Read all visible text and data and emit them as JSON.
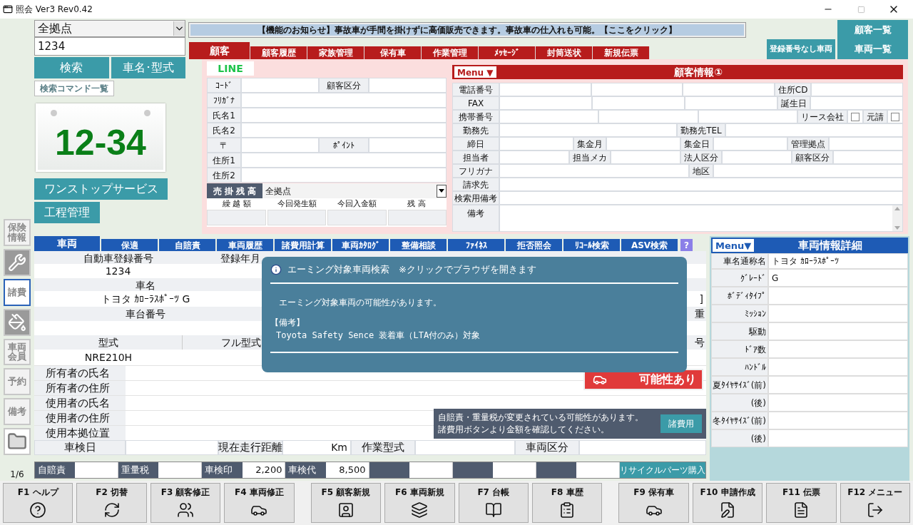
{
  "window": {
    "title": "照会 Ver3 Rev0.42"
  },
  "search": {
    "branch": "全拠点",
    "query": "1234",
    "buttons": [
      "検索",
      "車名･型式"
    ],
    "command_list": "検索コマンド一覧"
  },
  "plate": {
    "number": "12-34"
  },
  "side_buttons": [
    "ワンストップサービス",
    "工程管理"
  ],
  "notice": "【機能のお知らせ】事故車が手間を掛けずに高価販売できます。事故車の仕入れも可能。【ここをクリック】",
  "top_buttons": [
    "顧客一覧",
    "登録番号なし車両",
    "車両一覧"
  ],
  "customer_tabs": [
    {
      "label": "顧客",
      "selected": true
    },
    {
      "label": "顧客履歴",
      "selected": false
    },
    {
      "label": "家族管理",
      "selected": false
    },
    {
      "label": "保有車",
      "selected": false
    },
    {
      "label": "作業管理",
      "selected": false
    },
    {
      "label": "ﾒｯｾｰｼﾞ",
      "selected": false
    },
    {
      "label": "封筒送状",
      "selected": false
    },
    {
      "label": "新規伝票",
      "selected": false
    }
  ],
  "customer": {
    "line": "LINE",
    "rows": [
      [
        {
          "kind": "label",
          "text": "ｺｰﾄﾞ"
        },
        {
          "kind": "value"
        },
        {
          "kind": "label",
          "text": "顧客区分"
        },
        {
          "kind": "value"
        }
      ],
      [
        {
          "kind": "label",
          "text": "ﾌﾘｶﾞﾅ"
        },
        {
          "kind": "value"
        }
      ],
      [
        {
          "kind": "label",
          "text": "氏名1"
        },
        {
          "kind": "value"
        }
      ],
      [
        {
          "kind": "label",
          "text": "氏名2"
        },
        {
          "kind": "value"
        }
      ],
      [
        {
          "kind": "label",
          "text": "〒"
        },
        {
          "kind": "value"
        },
        {
          "kind": "label",
          "text": "ﾎﾟｲﾝﾄ"
        },
        {
          "kind": "value"
        }
      ],
      [
        {
          "kind": "label",
          "text": "住所1"
        },
        {
          "kind": "value"
        }
      ],
      [
        {
          "kind": "label",
          "text": "住所2"
        },
        {
          "kind": "value"
        }
      ]
    ],
    "balance": {
      "label": "売 掛 残 高",
      "branch": "全拠点",
      "columns": [
        "繰 越 額",
        "今回発生額",
        "今回入金額",
        "残 高"
      ]
    }
  },
  "customer_info": {
    "menu": "Menu ▼",
    "title": "顧客情報①",
    "rows": [
      [
        {
          "kind": "label",
          "text": "電話番号"
        },
        {
          "kind": "value"
        },
        {
          "kind": "value"
        },
        {
          "kind": "value"
        },
        {
          "kind": "label",
          "text": "住所CD"
        },
        {
          "kind": "value"
        }
      ],
      [
        {
          "kind": "label",
          "text": "FAX"
        },
        {
          "kind": "value"
        },
        {
          "kind": "value"
        },
        {
          "kind": "value"
        },
        {
          "kind": "label",
          "text": "誕生日"
        },
        {
          "kind": "value"
        }
      ],
      [
        {
          "kind": "label",
          "text": "携帯番号"
        },
        {
          "kind": "value"
        },
        {
          "kind": "value"
        },
        {
          "kind": "value"
        },
        {
          "kind": "label",
          "text": "リース会社"
        },
        {
          "kind": "checkbox",
          "checked": false
        },
        {
          "kind": "label",
          "text": "元請"
        },
        {
          "kind": "checkbox",
          "checked": false
        }
      ],
      [
        {
          "kind": "label",
          "text": "勤務先"
        },
        {
          "kind": "value"
        },
        {
          "kind": "label",
          "text": "勤務先TEL"
        },
        {
          "kind": "value"
        }
      ],
      [
        {
          "kind": "label",
          "text": "締日"
        },
        {
          "kind": "value"
        },
        {
          "kind": "label",
          "text": "集金月"
        },
        {
          "kind": "value"
        },
        {
          "kind": "label",
          "text": "集金日"
        },
        {
          "kind": "value"
        },
        {
          "kind": "label",
          "text": "管理拠点"
        },
        {
          "kind": "value"
        }
      ],
      [
        {
          "kind": "label",
          "text": "担当者"
        },
        {
          "kind": "value"
        },
        {
          "kind": "label",
          "text": "担当メカ"
        },
        {
          "kind": "value"
        },
        {
          "kind": "label",
          "text": "法人区分"
        },
        {
          "kind": "value"
        },
        {
          "kind": "label",
          "text": "顧客区分"
        },
        {
          "kind": "value"
        }
      ],
      [
        {
          "kind": "label",
          "text": "フリガナ"
        },
        {
          "kind": "value"
        },
        {
          "kind": "label",
          "text": "地区"
        },
        {
          "kind": "value"
        }
      ],
      [
        {
          "kind": "label",
          "text": "請求先"
        },
        {
          "kind": "value"
        }
      ],
      [
        {
          "kind": "label",
          "text": "検索用備考"
        },
        {
          "kind": "value"
        }
      ]
    ],
    "remarks_label": "備考"
  },
  "toolbar": [
    {
      "kind": "text",
      "label": "保険情報",
      "selected": false
    },
    {
      "kind": "wrench",
      "selected": false
    },
    {
      "kind": "text",
      "label": "諸費",
      "selected": true
    },
    {
      "kind": "pot",
      "selected": false
    },
    {
      "kind": "text",
      "label": "車両会員",
      "selected": false
    },
    {
      "kind": "text",
      "label": "予約",
      "selected": false
    },
    {
      "kind": "text",
      "label": "備考",
      "selected": false
    },
    {
      "kind": "folder",
      "selected": false
    }
  ],
  "page": "1/6",
  "vehicle_tabs": [
    {
      "label": "車両",
      "selected": true
    },
    {
      "label": "保適",
      "selected": false
    },
    {
      "label": "自賠責",
      "selected": false
    },
    {
      "label": "車両履歴",
      "selected": false
    },
    {
      "label": "諸費用計算",
      "selected": false
    },
    {
      "label": "車両ｶﾀﾛｸﾞ",
      "selected": false
    },
    {
      "label": "整備相談",
      "selected": false
    },
    {
      "label": "ﾌｧｲﾈｽ",
      "selected": false
    },
    {
      "label": "拒否照会",
      "selected": false
    },
    {
      "label": "ﾘｺｰﾙ検索",
      "selected": false
    },
    {
      "label": "ASV検索",
      "selected": false
    }
  ],
  "help_button": "?",
  "vehicle": {
    "reg_headers": [
      "自動車登録番号",
      "登録年月"
    ],
    "reg_number": "1234",
    "name_header": "車名",
    "name": "トヨタ ｶﾛｰﾗｽﾎﾟｰﾂ G",
    "name_end": "]",
    "chassis_header": "車台番号",
    "axle_header": "重",
    "model_headers": [
      "型式",
      "フル型式"
    ],
    "model_end_header": "号",
    "model": "NRE210H",
    "people_rows": [
      "所有者の氏名",
      "所有者の住所",
      "使用者の氏名",
      "使用者の住所",
      "使用本拠位置"
    ],
    "last_row": [
      {
        "kind": "label",
        "text": "車検日"
      },
      {
        "kind": "value"
      },
      {
        "kind": "label",
        "text": "現在走行距離"
      },
      {
        "kind": "value",
        "text": "Km"
      },
      {
        "kind": "label",
        "text": "作業型式"
      },
      {
        "kind": "value"
      },
      {
        "kind": "label",
        "text": "車両区分"
      },
      {
        "kind": "value"
      }
    ]
  },
  "fees": [
    {
      "kind": "label",
      "text": "自賠責"
    },
    {
      "kind": "value"
    },
    {
      "kind": "label",
      "text": "重量税"
    },
    {
      "kind": "value"
    },
    {
      "kind": "label",
      "text": "車検印"
    },
    {
      "kind": "value",
      "text": "2,200"
    },
    {
      "kind": "label",
      "text": "車検代"
    },
    {
      "kind": "value",
      "text": "8,500"
    },
    {
      "kind": "label"
    },
    {
      "kind": "value"
    },
    {
      "kind": "label"
    },
    {
      "kind": "value"
    },
    {
      "kind": "label"
    },
    {
      "kind": "value"
    }
  ],
  "recycle_button": "リサイクルパーツ購入",
  "popup": {
    "title": "エーミング対象車両検索　※クリックでブラウザを開きます",
    "message": "エーミング対象車両の可能性があります。",
    "remarks_label": "【備考】",
    "remarks": "Toyota Safety Sence 装着車（LTA付のみ）対象"
  },
  "aiming_badge": "可能性あり",
  "fee_notice": {
    "lines": [
      "自賠責・重量税が変更されている可能性があります。",
      "諸費用ボタンより金額を確認してください。"
    ],
    "button": "諸費用"
  },
  "detail": {
    "menu": "Menu▼",
    "title": "車両情報詳細",
    "rows": [
      {
        "label": "車名通称名",
        "value": "トヨタ ｶﾛｰﾗｽﾎﾟｰﾂ"
      },
      {
        "label": "ｸﾞﾚｰﾄﾞ",
        "value": "G"
      },
      {
        "label": "ﾎﾞﾃﾞｨﾀｲﾌﾟ"
      },
      {
        "label": "ﾐｯｼｮﾝ"
      },
      {
        "label": "駆動"
      },
      {
        "label": "ﾄﾞｱ数"
      },
      {
        "label": "ﾊﾝﾄﾞﾙ"
      },
      {
        "label": "夏ﾀｲﾔｻｲｽﾞ(前)"
      },
      {
        "label": "(後)"
      },
      {
        "label": "冬ﾀｲﾔｻｲｽﾞ(前)"
      },
      {
        "label": "(後)"
      }
    ]
  },
  "function_keys": [
    {
      "label": "F1 ヘルプ",
      "kind": "help"
    },
    {
      "label": "F2 切替",
      "kind": "switch"
    },
    {
      "label": "F3 顧客修正",
      "kind": "users"
    },
    {
      "label": "F4 車両修正",
      "kind": "cars"
    },
    {
      "label": "F5 顧客新規",
      "kind": "contact"
    },
    {
      "label": "F6 車両新規",
      "kind": "gallery"
    },
    {
      "label": "F7 台帳",
      "kind": "book"
    },
    {
      "label": "F8 車歴",
      "kind": "clipboard"
    },
    {
      "label": "F9 保有車",
      "kind": "car"
    },
    {
      "label": "F10 申請作成",
      "kind": "filepen"
    },
    {
      "label": "F11 伝票",
      "kind": "list"
    },
    {
      "label": "F12 メニュー",
      "kind": "exit"
    }
  ]
}
